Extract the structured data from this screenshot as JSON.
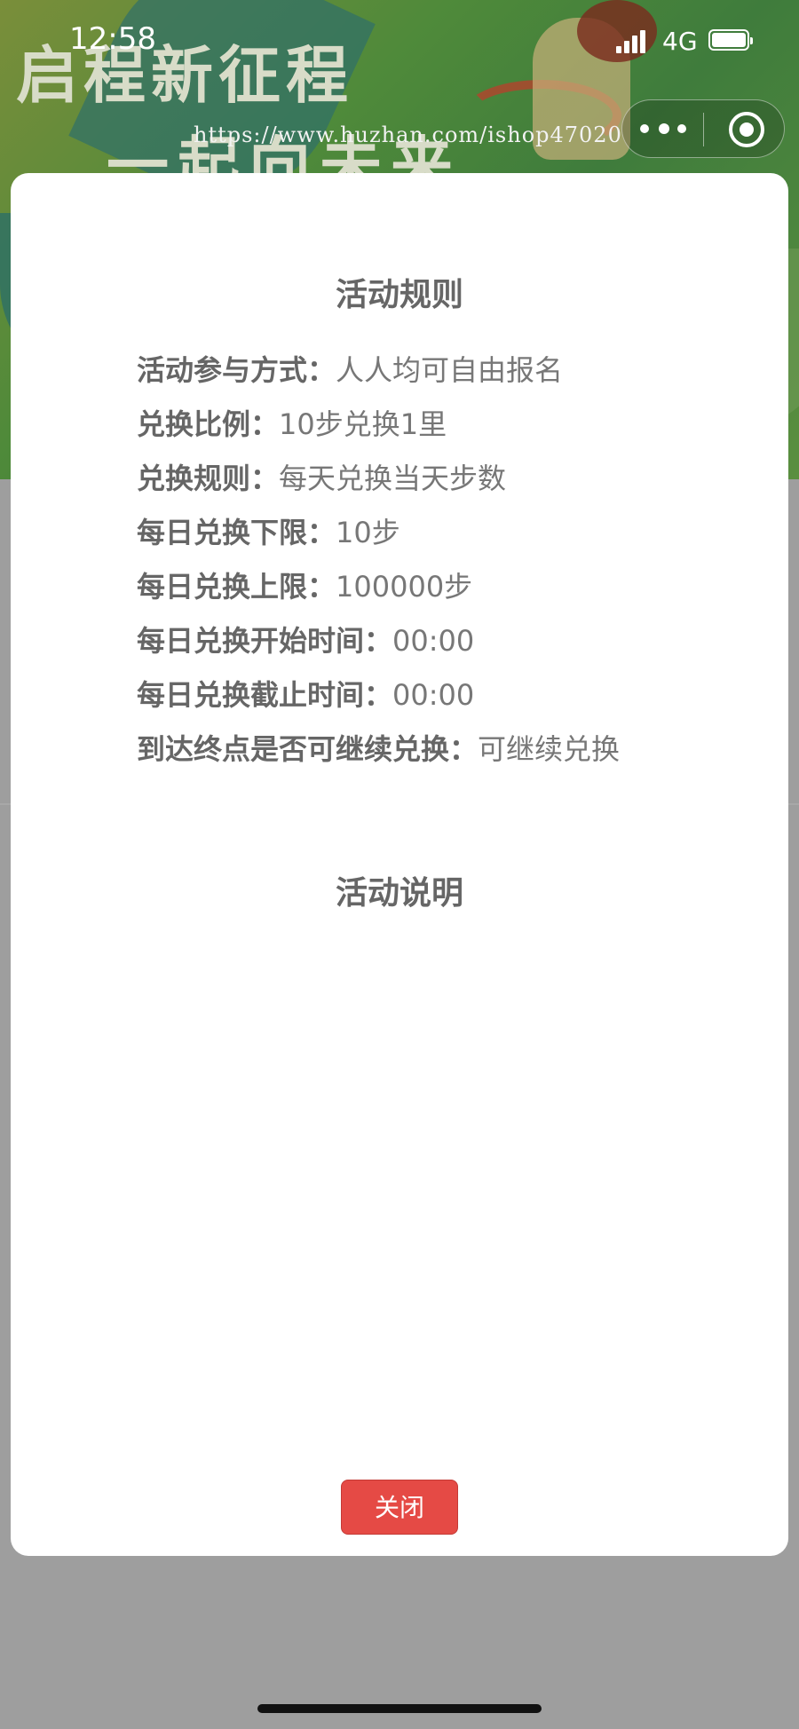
{
  "banner": {
    "title_line1": "启程新征程",
    "title_line2": "一起向未来"
  },
  "status_bar": {
    "time": "12:58",
    "network": "4G"
  },
  "watermark": "https://www.huzhan.com/ishop47020",
  "modal": {
    "rules_title": "活动规则",
    "rules": [
      {
        "label": "活动参与方式：",
        "value": "人人均可自由报名"
      },
      {
        "label": "兑换比例：",
        "value": "10步兑换1里"
      },
      {
        "label": "兑换规则：",
        "value": "每天兑换当天步数"
      },
      {
        "label": "每日兑换下限：",
        "value": "10步"
      },
      {
        "label": "每日兑换上限：",
        "value": "100000步"
      },
      {
        "label": "每日兑换开始时间：",
        "value": "00:00"
      },
      {
        "label": "每日兑换截止时间：",
        "value": "00:00"
      },
      {
        "label": "到达终点是否可继续兑换：",
        "value": "可继续兑换"
      }
    ],
    "description_title": "活动说明",
    "close_label": "关闭"
  },
  "colors": {
    "close_button": "#e54a45",
    "overlay": "#9a9a9a"
  }
}
